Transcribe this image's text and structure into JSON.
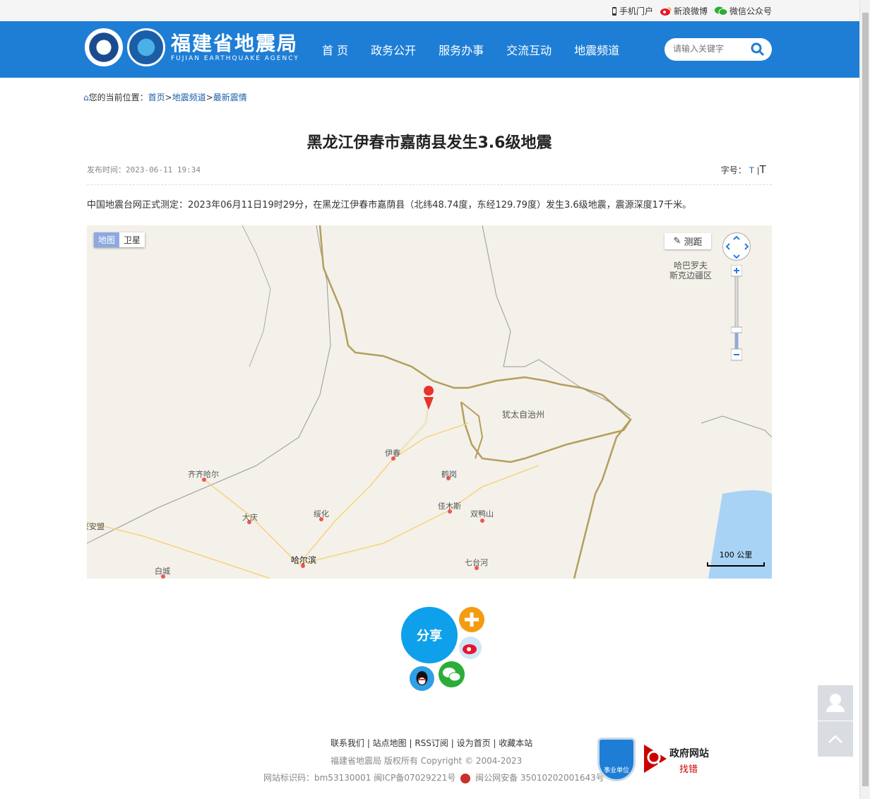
{
  "topbar": {
    "mobile": "手机门户",
    "weibo": "新浪微博",
    "wechat": "微信公众号"
  },
  "header": {
    "site_name": "福建省地震局",
    "site_name_en": "FUJIAN EARTHQUAKE AGENCY",
    "nav": [
      "首 页",
      "政务公开",
      "服务办事",
      "交流互动",
      "地震频道"
    ],
    "search_placeholder": "请输入关键字"
  },
  "breadcrumb": {
    "prefix": "您的当前位置：",
    "items": [
      "首页",
      "地震频道",
      "最新震情"
    ],
    "sep": ">"
  },
  "article": {
    "title": "黑龙江伊春市嘉荫县发生3.6级地震",
    "publish": "发布时间：2023-06-11 19:34",
    "fontsize_label": "字号：",
    "fontsize_small": "T",
    "fontsize_sep": "|",
    "fontsize_large": "T",
    "body": "中国地震台网正式测定：2023年06月11日19时29分，在黑龙江伊春市嘉荫县（北纬48.74度，东经129.79度）发生3.6级地震，震源深度17千米。"
  },
  "map": {
    "type_map": "地图",
    "type_sat": "卫星",
    "measure": "测距",
    "scale": "100 公里",
    "labels": [
      "哈巴罗夫",
      "斯克边疆区",
      "犹太自治州",
      "伊春",
      "鹤岗",
      "佳木斯",
      "双鸭山",
      "齐齐哈尔",
      "大庆",
      "绥化",
      "哈尔滨",
      "七台河",
      "兴安盟",
      "白城"
    ]
  },
  "share": {
    "label": "分享"
  },
  "footer": {
    "links": "联系我们 | 站点地图 | RSS订阅 | 设为首页 | 收藏本站",
    "copyright": "福建省地震局   版权所有    Copyright © 2004-2023",
    "site_id": "网站标识码：bm53130001   闽ICP备07029221号",
    "police": "闽公网安备 35010202001643号",
    "badge": "事业单位",
    "gov_title": "政府网站",
    "gov_sub": "找错"
  }
}
